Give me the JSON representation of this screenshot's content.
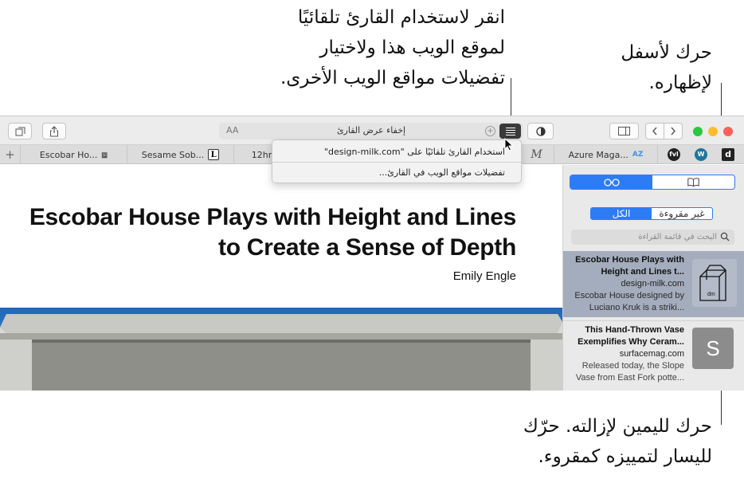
{
  "callouts": {
    "reader": [
      "انقر لاستخدام القارئ تلقائيًا",
      "لموقع الويب هذا ولاختيار",
      "تفضيلات مواقع الويب الأخرى."
    ],
    "scroll_down": [
      "حرك لأسفل",
      "لإظهاره."
    ],
    "swipe": [
      "حرك لليمين لإزالته. حرّك",
      "لليسار لتمييزه كمقروء."
    ]
  },
  "address_bar": {
    "text_size_label": "AA",
    "url_text": "إخفاء عرض القارئ"
  },
  "tabs": [
    {
      "title": "Escobar Ho...",
      "icon": "box-icon"
    },
    {
      "title": "Sesame Sob...",
      "icon": "L"
    },
    {
      "title": "12hr",
      "icon": ""
    },
    {
      "title": "M",
      "icon": ""
    },
    {
      "title": "Azure Maga...",
      "icon": "AZ"
    }
  ],
  "pinned_tabs": [
    "fvl",
    "W",
    "d"
  ],
  "reader_menu": {
    "items": [
      "استخدام القارئ تلقائيًا على \"design-milk.com\"",
      "تفضيلات مواقع الويب في القارئ..."
    ]
  },
  "article": {
    "title": "Escobar House Plays with Height and Lines to Create a Sense of Depth",
    "author": "Emily Engle"
  },
  "sidebar": {
    "filter": {
      "all": "الكل",
      "unread": "غير مقروءة"
    },
    "search_placeholder": "البحث في قائمة القراءة",
    "items": [
      {
        "title": "Escobar House Plays with Height and Lines t...",
        "domain": "design-milk.com",
        "excerpt": "Escobar House designed by Luciano Kruk is a striki...",
        "thumb": "dm"
      },
      {
        "title": "This Hand-Thrown Vase Exemplifies Why Ceram...",
        "domain": "surfacemag.com",
        "excerpt": "Released today, the Slope Vase from East Fork potte...",
        "thumb": "S"
      }
    ]
  },
  "colors": {
    "accent": "#2d7cf6",
    "selected_row": "#a4adbd"
  }
}
